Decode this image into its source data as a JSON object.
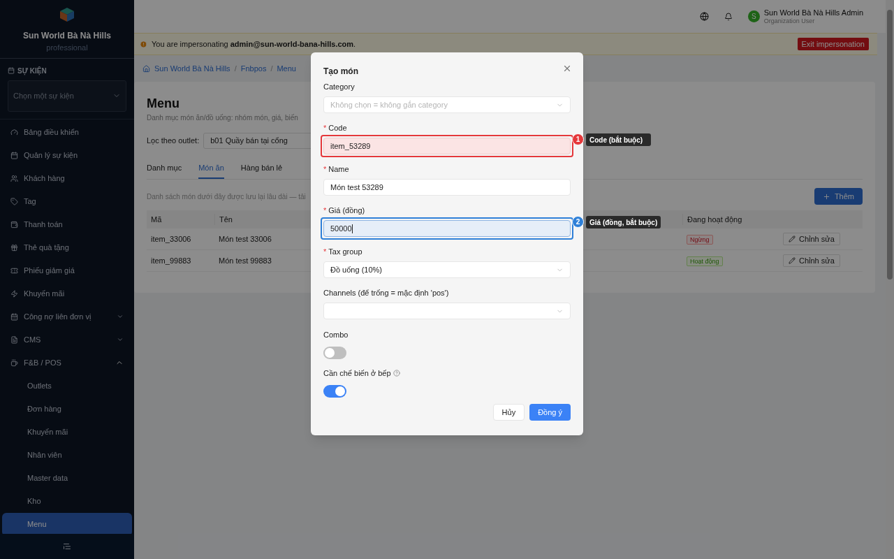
{
  "sidebar": {
    "brand": "Sun World Bà Nà Hills",
    "plan": "professional",
    "event_section": {
      "label": "SỰ KIỆN",
      "select_placeholder": "Chọn một sự kiện"
    },
    "items": [
      {
        "label": "Bảng điều khiển",
        "selected": false
      },
      {
        "label": "Quản lý sự kiện",
        "selected": false
      },
      {
        "label": "Khách hàng",
        "selected": false
      },
      {
        "label": "Tag",
        "selected": false
      },
      {
        "label": "Thanh toán",
        "selected": false
      },
      {
        "label": "Thẻ quà tặng",
        "selected": false
      },
      {
        "label": "Phiếu giảm giá",
        "selected": false
      },
      {
        "label": "Khuyến mãi",
        "selected": false
      },
      {
        "label": "Công nợ liên đơn vị",
        "expanded": false,
        "selected": false
      },
      {
        "label": "CMS",
        "expanded": false,
        "selected": false
      },
      {
        "label": "F&B / POS",
        "expanded": true,
        "selected": false,
        "children": [
          {
            "label": "Outlets",
            "selected": false
          },
          {
            "label": "Đơn hàng",
            "selected": false
          },
          {
            "label": "Khuyến mãi",
            "selected": false
          },
          {
            "label": "Nhân viên",
            "selected": false
          },
          {
            "label": "Master data",
            "selected": false
          },
          {
            "label": "Kho",
            "selected": false
          },
          {
            "label": "Menu",
            "selected": true
          }
        ]
      }
    ]
  },
  "topbar": {
    "user": {
      "initial": "S",
      "name": "Sun World Bà Nà Hills Admin",
      "role": "Organization User"
    }
  },
  "banner": {
    "text": "You are impersonating **admin@sun-world-bana-hills.com**.",
    "button": "Exit impersonation"
  },
  "breadcrumb": {
    "separator": "/",
    "items": [
      "Sun World Bà Nà Hills",
      "Fnbpos",
      "Menu"
    ]
  },
  "page": {
    "title": "Menu",
    "subtitle": "Danh mục món ăn/đồ uống: nhóm món, giá, biến",
    "filter": {
      "label": "Lọc theo outlet:",
      "value": "b01 Quầy bán tại cổng"
    },
    "tabs": [
      {
        "label": "Danh mục",
        "selected": false
      },
      {
        "label": "Món ăn",
        "selected": true
      },
      {
        "label": "Hàng bán lẻ",
        "selected": false
      }
    ],
    "list_note": "Danh sách món dưới đây được lưu lại lâu dài — tải",
    "add_button": "Thêm",
    "table": {
      "columns": [
        "Mã",
        "Tên",
        "",
        "",
        "",
        "Đang hoạt động",
        ""
      ],
      "rows": [
        {
          "code": "item_33006",
          "name": "Món test 33006",
          "status": {
            "label": "Ngừng",
            "kind": "inactive"
          },
          "action": "Chỉnh sửa"
        },
        {
          "code": "item_99883",
          "name": "Món test 99883",
          "status": {
            "label": "Hoạt động",
            "kind": "active"
          },
          "action": "Chỉnh sửa"
        }
      ]
    }
  },
  "modal": {
    "title": "Tạo món",
    "required_mark": "*",
    "fields": [
      {
        "kind": "select",
        "label": "Category",
        "placeholder": "Không chọn = không gắn category"
      },
      {
        "kind": "text",
        "label": "Code",
        "required": true,
        "value": "item_53289",
        "focused": false,
        "highlight": {
          "number": "1",
          "text": "Code (bắt buộc)",
          "color": "#e5383b"
        }
      },
      {
        "kind": "text",
        "label": "Name",
        "required": true,
        "value": "Món test 53289",
        "focused": false
      },
      {
        "kind": "text",
        "label": "Giá (đồng)",
        "required": true,
        "value": "50000",
        "focused": true,
        "highlight": {
          "number": "2",
          "text": "Giá (đồng, bắt buộc)",
          "color": "#2f80d8"
        }
      },
      {
        "kind": "select",
        "label": "Tax group",
        "required": true,
        "value": "Đồ uống (10%)"
      },
      {
        "kind": "select",
        "label": "Channels (để trống = mặc định 'pos')"
      },
      {
        "kind": "switch",
        "label": "Combo",
        "on": false
      },
      {
        "kind": "switch",
        "label": "Cần chế biến ở bếp",
        "on": true,
        "help": true
      }
    ],
    "buttons": [
      {
        "label": "Hủy",
        "kind": "secondary"
      },
      {
        "label": "Đồng ý",
        "kind": "primary"
      }
    ]
  }
}
